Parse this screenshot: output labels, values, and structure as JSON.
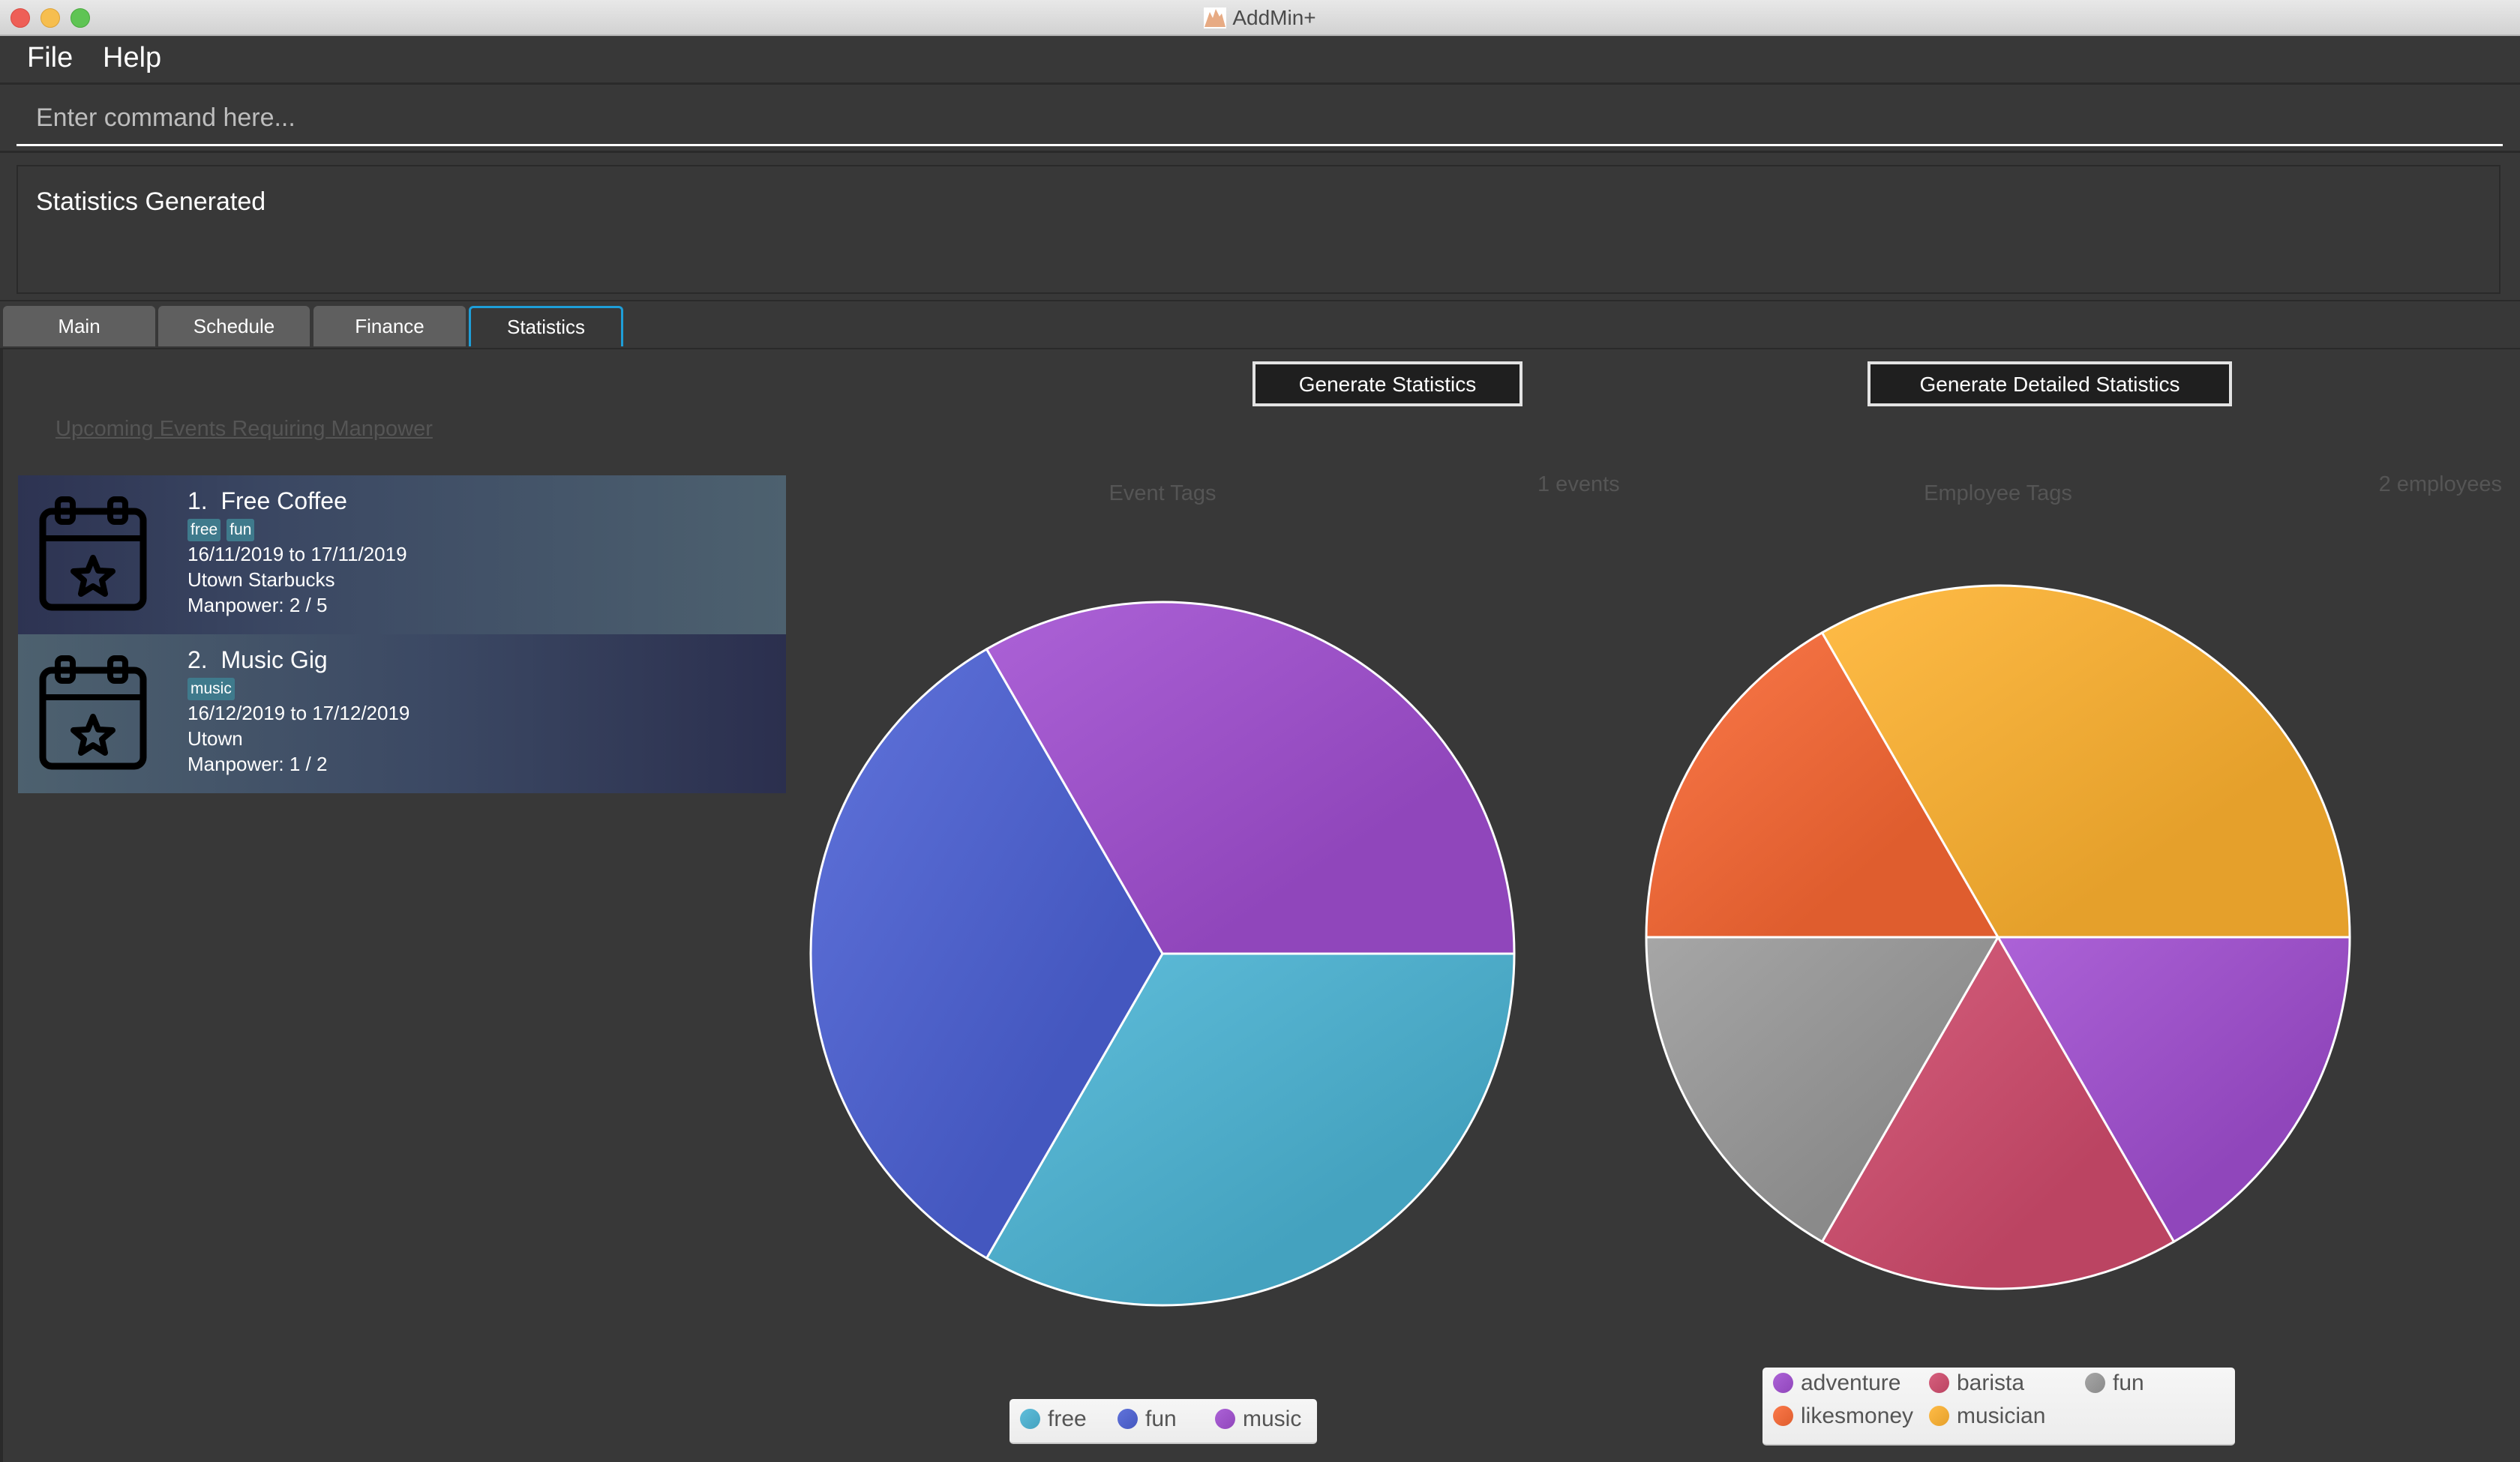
{
  "window": {
    "title": "AddMin+",
    "logo_text": "AddMin+"
  },
  "menu": {
    "items": [
      {
        "label": "File"
      },
      {
        "label": "Help"
      }
    ]
  },
  "command": {
    "value": "",
    "placeholder": "Enter command here..."
  },
  "result": {
    "message": "Statistics Generated"
  },
  "tabs": [
    {
      "label": "Main",
      "selected": false
    },
    {
      "label": "Schedule",
      "selected": false
    },
    {
      "label": "Finance",
      "selected": false
    },
    {
      "label": "Statistics",
      "selected": true
    }
  ],
  "statistics": {
    "generate_button": "Generate Statistics",
    "generate_detailed_button": "Generate Detailed Statistics",
    "upcoming_link": "Upcoming Events Requiring Manpower",
    "events": [
      {
        "index": "1.",
        "name": "Free Coffee",
        "tags": [
          "free",
          "fun"
        ],
        "dates": "16/11/2019 to 17/11/2019",
        "venue": "Utown Starbucks",
        "manpower": "Manpower: 2 / 5",
        "icon": "calendar-star-icon"
      },
      {
        "index": "2.",
        "name": "Music Gig",
        "tags": [
          "music"
        ],
        "dates": "16/12/2019 to 17/12/2019",
        "venue": "Utown",
        "manpower": "Manpower: 1 / 2",
        "icon": "calendar-star-icon"
      }
    ]
  },
  "chart_data": [
    {
      "type": "pie",
      "title": "Event Tags",
      "annotation": "1 events",
      "categories": [
        "free",
        "fun",
        "music"
      ],
      "values": [
        1,
        1,
        1
      ],
      "colors": [
        "#44a2bf",
        "#4457bf",
        "#9046bb"
      ],
      "start_angle_deg": 0,
      "direction": "clockwise",
      "legend": "bottom"
    },
    {
      "type": "pie",
      "title": "Employee Tags",
      "annotation": "2 employees",
      "categories": [
        "adventure",
        "barista",
        "fun",
        "likesmoney",
        "musician"
      ],
      "values": [
        1,
        1,
        1,
        1,
        2
      ],
      "colors": [
        "#9046bb",
        "#bb4462",
        "#8a8a8a",
        "#df5d2e",
        "#e5a02b"
      ],
      "start_angle_deg": 0,
      "direction": "clockwise",
      "legend": "bottom"
    }
  ]
}
